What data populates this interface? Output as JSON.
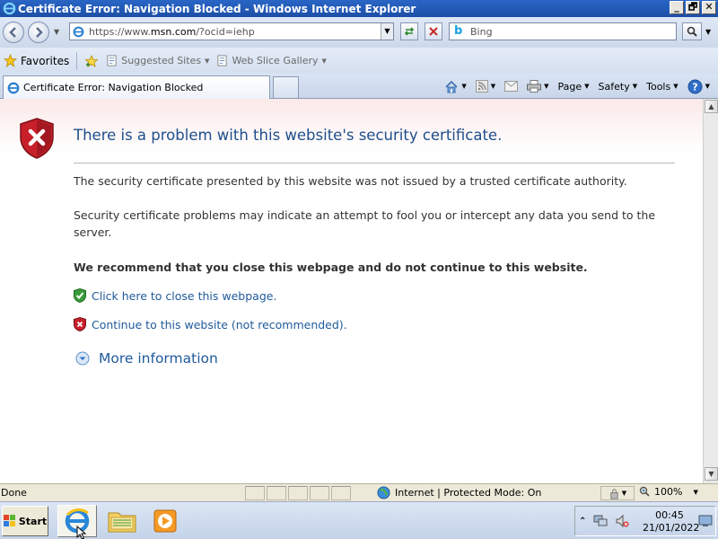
{
  "window": {
    "title": "Certificate Error: Navigation Blocked - Windows Internet Explorer",
    "buttons": {
      "minimize": "_",
      "maximize": "🗗",
      "close": "✕"
    }
  },
  "toolbar": {
    "address_url_prefix": "https://www.",
    "address_url_domain": "msn.com",
    "address_url_path": "/?ocid=iehp",
    "search_placeholder": "Bing"
  },
  "favorites_bar": {
    "favorites_label": "Favorites",
    "suggested_sites": "Suggested Sites",
    "web_slice_gallery": "Web Slice Gallery"
  },
  "tabs": [
    {
      "label": "Certificate Error: Navigation Blocked"
    }
  ],
  "command_bar": {
    "page": "Page",
    "safety": "Safety",
    "tools": "Tools"
  },
  "content": {
    "heading": "There is a problem with this website's security certificate.",
    "para1": "The security certificate presented by this website was not issued by a trusted certificate authority.",
    "para2": "Security certificate problems may indicate an attempt to fool you or intercept any data you send to the server.",
    "recommend": "We recommend that you close this webpage and do not continue to this website.",
    "close_link": "Click here to close this webpage.",
    "continue_link": "Continue to this website (not recommended).",
    "more_info": "More information"
  },
  "status_bar": {
    "status_text": "Done",
    "zone_text": "Internet | Protected Mode: On",
    "zoom": "100%"
  },
  "taskbar": {
    "start_label": "Start",
    "time": "00:45",
    "date": "21/01/2022"
  },
  "colors": {
    "link": "#1f5a9a",
    "heading": "#1f4e8c",
    "shield_red": "#c8202a",
    "shield_green": "#3a9a3a"
  }
}
